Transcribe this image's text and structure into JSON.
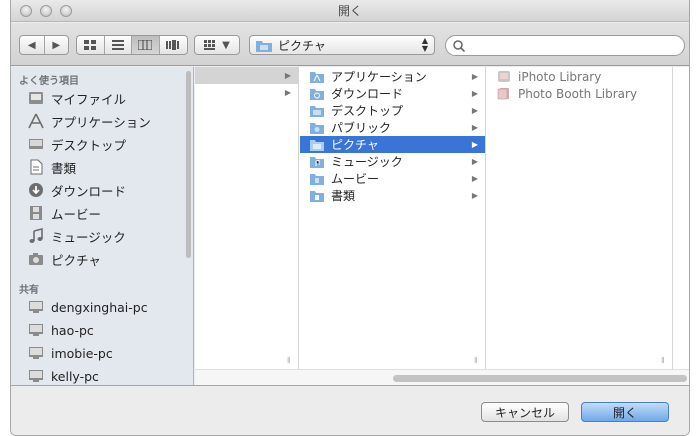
{
  "window": {
    "title": "開く"
  },
  "toolbar": {
    "path_label": "ピクチャ",
    "search_placeholder": ""
  },
  "sidebar": {
    "favorites_header": "よく使う項目",
    "favorites": [
      {
        "label": "マイファイル",
        "icon": "all-files-icon"
      },
      {
        "label": "アプリケーション",
        "icon": "applications-icon"
      },
      {
        "label": "デスクトップ",
        "icon": "desktop-icon"
      },
      {
        "label": "書類",
        "icon": "documents-icon"
      },
      {
        "label": "ダウンロード",
        "icon": "downloads-icon"
      },
      {
        "label": "ムービー",
        "icon": "movies-icon"
      },
      {
        "label": "ミュージック",
        "icon": "music-icon"
      },
      {
        "label": "ピクチャ",
        "icon": "pictures-icon"
      }
    ],
    "shared_header": "共有",
    "shared": [
      {
        "label": "dengxinghai-pc",
        "icon": "computer-icon"
      },
      {
        "label": "hao-pc",
        "icon": "computer-icon"
      },
      {
        "label": "imobie-pc",
        "icon": "computer-icon"
      },
      {
        "label": "kelly-pc",
        "icon": "computer-icon"
      }
    ]
  },
  "columns": {
    "col2": [
      {
        "label": "アプリケーション"
      },
      {
        "label": "ダウンロード"
      },
      {
        "label": "デスクトップ"
      },
      {
        "label": "パブリック"
      },
      {
        "label": "ピクチャ"
      },
      {
        "label": "ミュージック"
      },
      {
        "label": "ムービー"
      },
      {
        "label": "書類"
      }
    ],
    "col3": [
      {
        "label": "iPhoto Library"
      },
      {
        "label": "Photo Booth Library"
      }
    ]
  },
  "buttons": {
    "cancel": "キャンセル",
    "open": "開く"
  },
  "colors": {
    "selection": "#3875d7",
    "sidebar_bg": "#e3e8ee",
    "folder": "#7fb0e0"
  }
}
